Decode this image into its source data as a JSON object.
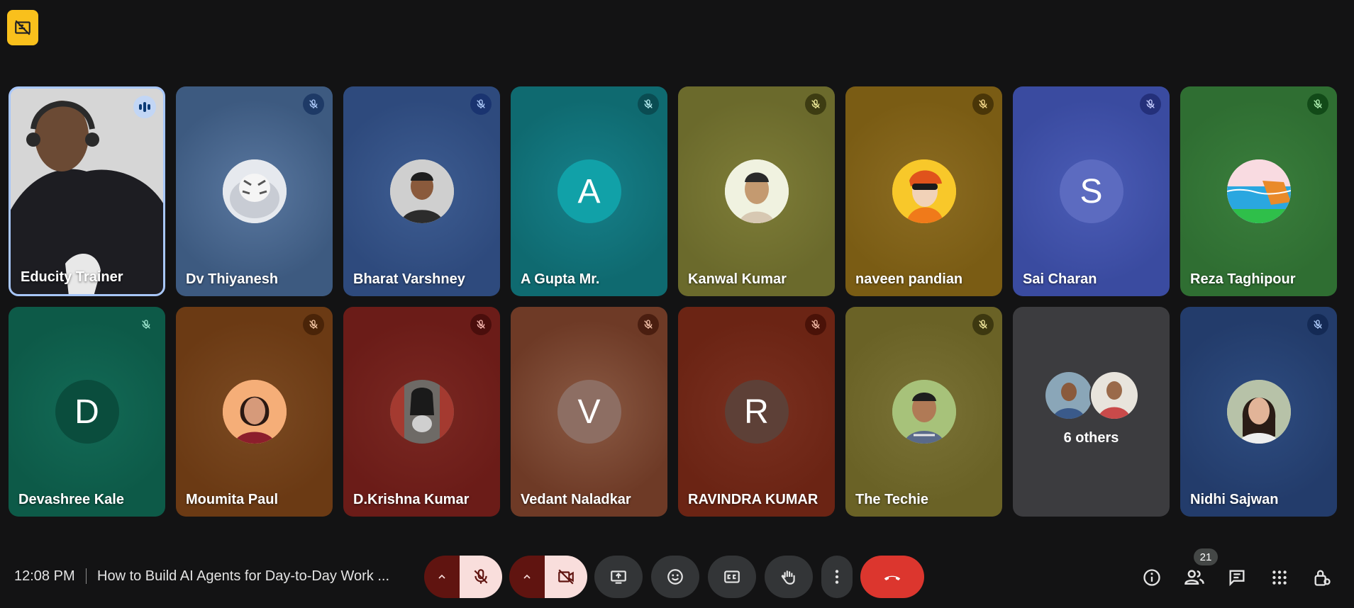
{
  "participants_row1": [
    {
      "name": "Educity Trainer",
      "bg": "#cfcfcf"
    },
    {
      "name": "Dv Thiyanesh",
      "bg": "#3d5a80"
    },
    {
      "name": "Bharat Varshney",
      "bg": "#2e4a7d"
    },
    {
      "name": "A Gupta Mr.",
      "letter": "A",
      "bg": "#0f6a70"
    },
    {
      "name": "Kanwal Kumar",
      "bg": "#6b6a2c"
    },
    {
      "name": "naveen pandian",
      "bg": "#7a5c14"
    },
    {
      "name": "Sai Charan",
      "letter": "S",
      "bg": "#3a4ba0"
    },
    {
      "name": "Reza Taghipour",
      "bg": "#2f6e32"
    }
  ],
  "participants_row2": [
    {
      "name": "Devashree Kale",
      "letter": "D",
      "bg": "#0d5a48"
    },
    {
      "name": "Moumita Paul",
      "bg": "#6b3a14"
    },
    {
      "name": "D.Krishna Kumar",
      "bg": "#6b1c18"
    },
    {
      "name": "Vedant Naladkar",
      "letter": "V",
      "bg": "#6e3a26"
    },
    {
      "name": "RAVINDRA KUMAR",
      "letter": "R",
      "bg": "#6b2414"
    },
    {
      "name": "The Techie",
      "bg": "#6a6226"
    },
    {
      "name": "6 others",
      "bg": "#3c3c3f"
    },
    {
      "name": "Nidhi Sajwan",
      "bg": "#233c6b"
    }
  ],
  "bottom_bar": {
    "time": "12:08 PM",
    "meeting_title": "How to Build AI Agents for Day-to-Day Work ...",
    "people_count": "21"
  },
  "icons": {
    "top_badge": "no-video-icon",
    "mic": "mic-off-icon",
    "cam": "camera-off-icon",
    "present": "present-screen-icon",
    "emoji": "emoji-icon",
    "captions": "captions-icon",
    "hand": "raise-hand-icon",
    "more": "more-vert-icon",
    "end": "end-call-icon",
    "info": "info-icon",
    "people": "people-icon",
    "chat": "chat-icon",
    "activities": "apps-icon",
    "lock": "host-controls-icon"
  },
  "colors": {
    "end_call": "#dc362e",
    "active_border": "#a8c7fa",
    "badge_yellow": "#f9c01c"
  }
}
